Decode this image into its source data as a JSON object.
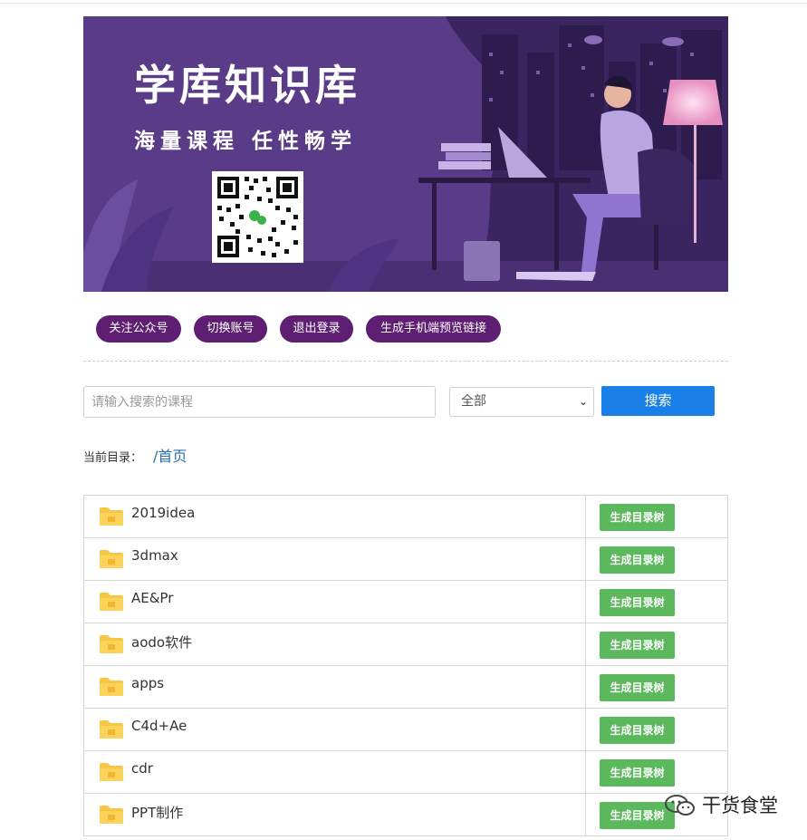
{
  "banner": {
    "title": "学库知识库",
    "subtitle": "海量课程 任性畅学",
    "colors": {
      "bg": "#5a3b87",
      "lamp": "#f6b7d8"
    }
  },
  "actions": [
    {
      "label": "关注公众号"
    },
    {
      "label": "切换账号"
    },
    {
      "label": "退出登录"
    },
    {
      "label": "生成手机端预览链接"
    }
  ],
  "search": {
    "placeholder": "请输入搜索的课程",
    "value": "",
    "scope_selected": "全部",
    "button_label": "搜索"
  },
  "breadcrumb": {
    "label": "当前目录：",
    "path": "/首页"
  },
  "folders": {
    "button_label": "生成目录树",
    "items": [
      {
        "name": "2019idea"
      },
      {
        "name": "3dmax"
      },
      {
        "name": "AE&Pr"
      },
      {
        "name": "aodo软件"
      },
      {
        "name": "apps"
      },
      {
        "name": "C4d+Ae"
      },
      {
        "name": "cdr"
      },
      {
        "name": "PPT制作"
      }
    ]
  },
  "watermark": {
    "text": "干货食堂",
    "icon": "wechat-icon"
  },
  "colors": {
    "pill": "#5e1f72",
    "search_button": "#1a7fe6",
    "tree_button": "#5cb85c",
    "link": "#2a6fb5",
    "folder": "#f7c744"
  }
}
